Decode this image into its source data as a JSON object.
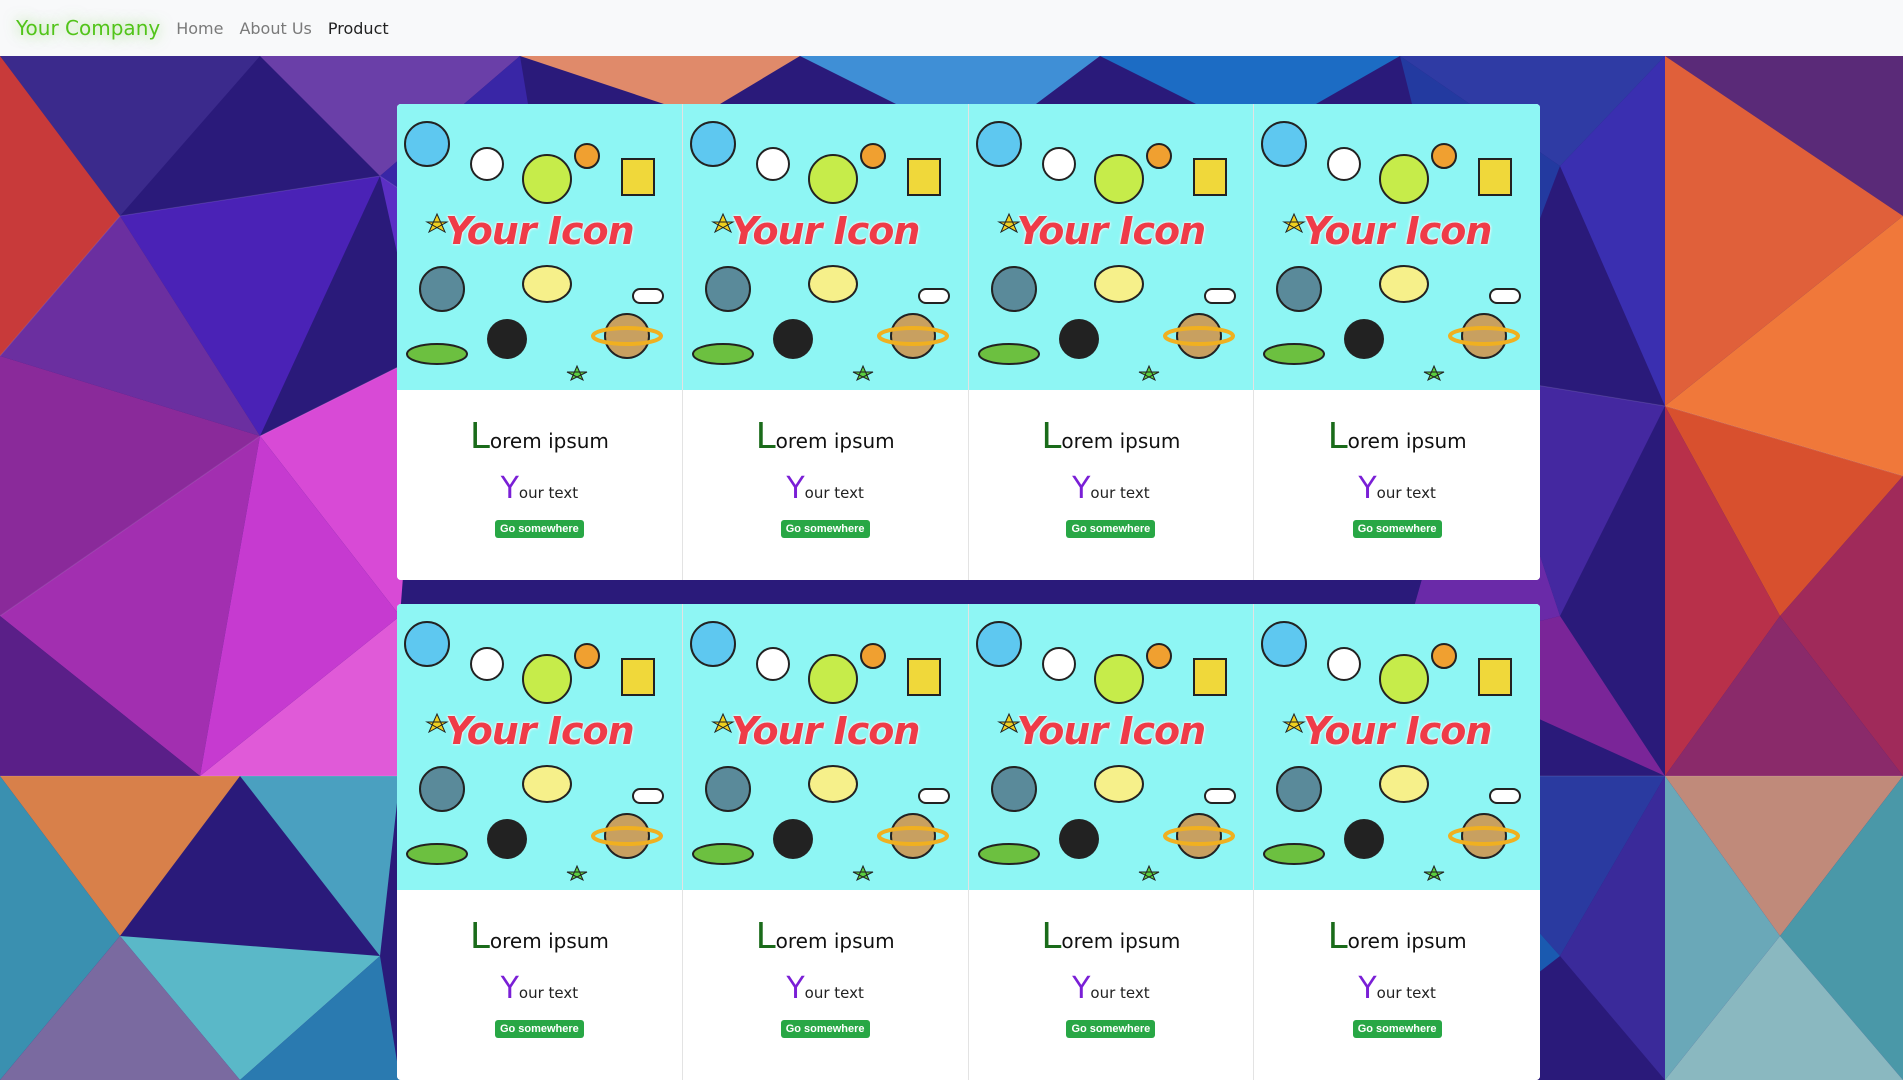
{
  "navbar": {
    "brand": "Your Company",
    "links": [
      {
        "label": "Home",
        "active": false
      },
      {
        "label": "About Us",
        "active": false
      },
      {
        "label": "Product",
        "active": true
      }
    ]
  },
  "colors": {
    "brand": "#52c41a",
    "card_image_bg": "#8ef6f4",
    "icon_text": "#ef3b48",
    "title_cap": "#1a6b1a",
    "text_cap": "#7a1fd6",
    "button": "#28a745"
  },
  "cards": [
    {
      "image_text": "Your Icon",
      "title_cap": "L",
      "title_rest": "orem ipsum",
      "text_cap": "Y",
      "text_rest": "our text",
      "button": "Go somewhere"
    },
    {
      "image_text": "Your Icon",
      "title_cap": "L",
      "title_rest": "orem ipsum",
      "text_cap": "Y",
      "text_rest": "our text",
      "button": "Go somewhere"
    },
    {
      "image_text": "Your Icon",
      "title_cap": "L",
      "title_rest": "orem ipsum",
      "text_cap": "Y",
      "text_rest": "our text",
      "button": "Go somewhere"
    },
    {
      "image_text": "Your Icon",
      "title_cap": "L",
      "title_rest": "orem ipsum",
      "text_cap": "Y",
      "text_rest": "our text",
      "button": "Go somewhere"
    },
    {
      "image_text": "Your Icon",
      "title_cap": "L",
      "title_rest": "orem ipsum",
      "text_cap": "Y",
      "text_rest": "our text",
      "button": "Go somewhere"
    },
    {
      "image_text": "Your Icon",
      "title_cap": "L",
      "title_rest": "orem ipsum",
      "text_cap": "Y",
      "text_rest": "our text",
      "button": "Go somewhere"
    },
    {
      "image_text": "Your Icon",
      "title_cap": "L",
      "title_rest": "orem ipsum",
      "text_cap": "Y",
      "text_rest": "our text",
      "button": "Go somewhere"
    },
    {
      "image_text": "Your Icon",
      "title_cap": "L",
      "title_rest": "orem ipsum",
      "text_cap": "Y",
      "text_rest": "our text",
      "button": "Go somewhere"
    }
  ]
}
